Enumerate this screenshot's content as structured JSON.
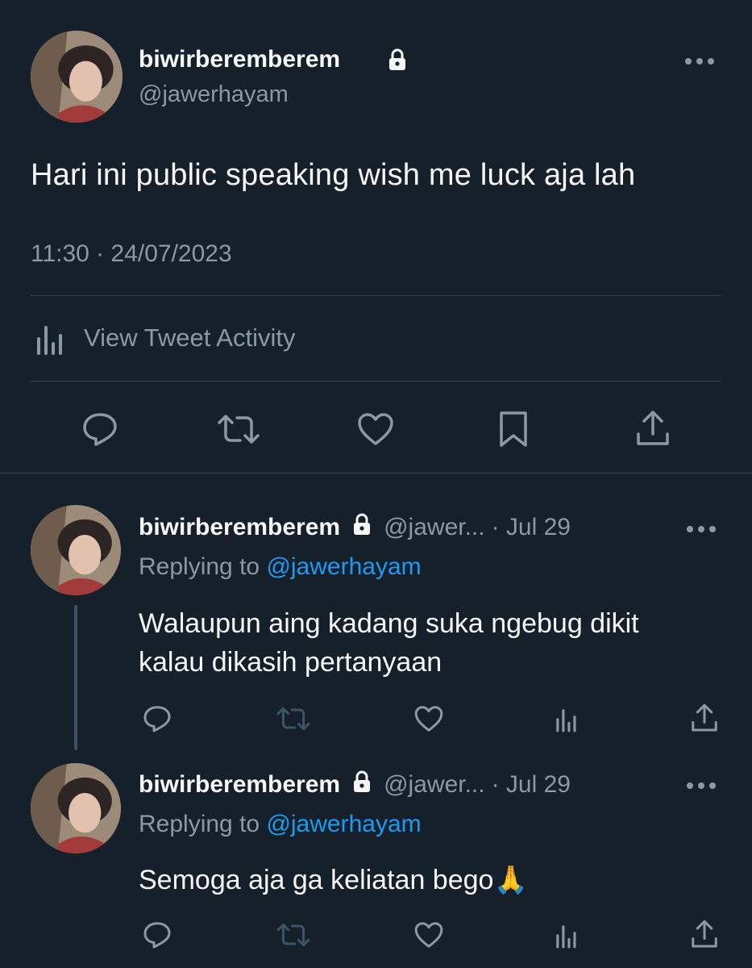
{
  "main_tweet": {
    "display_name": "biwirberemberem",
    "handle": "@jawerhayam",
    "text": "Hari ini public speaking wish me luck aja lah",
    "timestamp": "11:30 · 24/07/2023",
    "activity_label": "View Tweet Activity",
    "icons": [
      "reply-icon",
      "retweet-icon",
      "like-icon",
      "bookmark-icon",
      "share-icon"
    ]
  },
  "replies": [
    {
      "display_name": "biwirberemberem",
      "handle": "@jawer...",
      "date": "· Jul 29",
      "replying_prefix": "Replying to",
      "replying_to": "@jawerhayam",
      "text_line1": "Walaupun aing kadang suka ngebug dikit",
      "text_line2": "kalau dikasih pertanyaan"
    },
    {
      "display_name": "biwirberemberem",
      "handle": "@jawer...",
      "date": "· Jul 29",
      "replying_prefix": "Replying to",
      "replying_to": "@jawerhayam",
      "text": "Semoga aja ga keliatan bego🙏"
    }
  ],
  "colors": {
    "background": "#15202b",
    "text": "#f7f9f9",
    "muted": "#8b98a5",
    "link": "#1d9bf0",
    "divider": "#38444d"
  }
}
